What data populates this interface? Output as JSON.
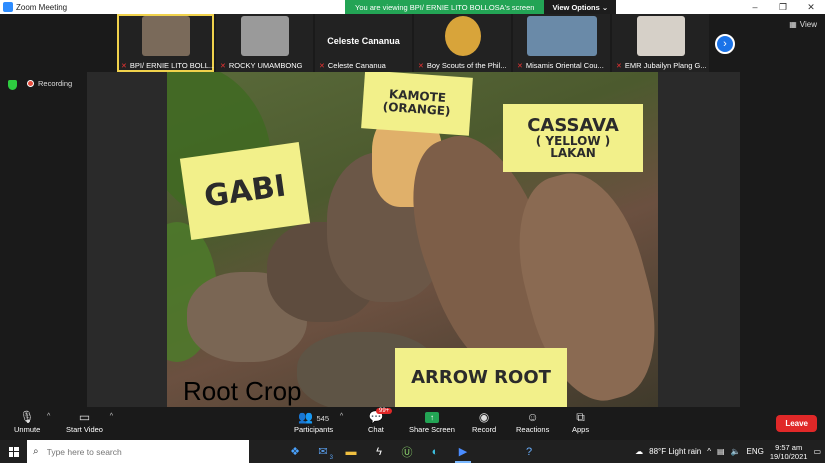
{
  "window": {
    "title": "Zoom Meeting",
    "controls": [
      "–",
      "❐",
      "✕"
    ]
  },
  "share_banner": {
    "message": "You are viewing BPI/ ERNIE LITO BOLLOSA's screen",
    "options_label": "View Options ⌄"
  },
  "view_button": {
    "label": "View"
  },
  "participants_strip": [
    {
      "name": "BPI/ ERNIE LITO BOLL...",
      "active": true,
      "color": "#7a6a5a"
    },
    {
      "name": "ROCKY UMAMBONG",
      "active": false,
      "color": "#9a9a9a"
    },
    {
      "name": "Celeste Cananua",
      "big_name": "Celeste Cananua",
      "active": false,
      "color": "#222222"
    },
    {
      "name": "Boy Scouts of the Phil...",
      "active": false,
      "color": "#d8a43a"
    },
    {
      "name": "Misamis Oriental Cou...",
      "active": false,
      "color": "#6a8aa8"
    },
    {
      "name": "EMR Jubailyn Plang G...",
      "active": false,
      "color": "#d6d0c8"
    }
  ],
  "recording": {
    "label": "Recording"
  },
  "slide": {
    "labels": {
      "kamote": "KAMOTE",
      "kamote_sub": "(ORANGE)",
      "cassava": "CASSAVA",
      "cassava_sub": "( YELLOW )",
      "cassava_sub2": "LAKAN",
      "gabi": "GABI",
      "arrow_root": "ARROW ROOT"
    },
    "title": "Root Crop"
  },
  "toolbar": {
    "unmute": "Unmute",
    "start_video": "Start Video",
    "participants": "Participants",
    "participants_count": "545",
    "chat": "Chat",
    "chat_badge": "99+",
    "share_screen": "Share Screen",
    "record": "Record",
    "reactions": "Reactions",
    "apps": "Apps",
    "leave": "Leave"
  },
  "taskbar": {
    "search_placeholder": "Type here to search",
    "weather": "88°F  Light rain",
    "lang": "ENG",
    "time": "9:57 am",
    "date": "19/10/2021",
    "mail_badge": "3"
  }
}
